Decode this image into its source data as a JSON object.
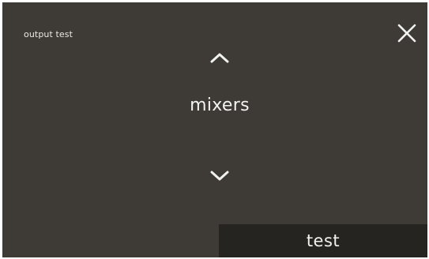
{
  "screen": {
    "title": "output test",
    "selection": "mixers",
    "test_button_label": "test"
  },
  "icons": {
    "close": "close-icon",
    "up": "chevron-up-icon",
    "down": "chevron-down-icon"
  },
  "colors": {
    "background": "#3e3b37",
    "button_background": "#262421",
    "text": "#f1f1ef"
  }
}
